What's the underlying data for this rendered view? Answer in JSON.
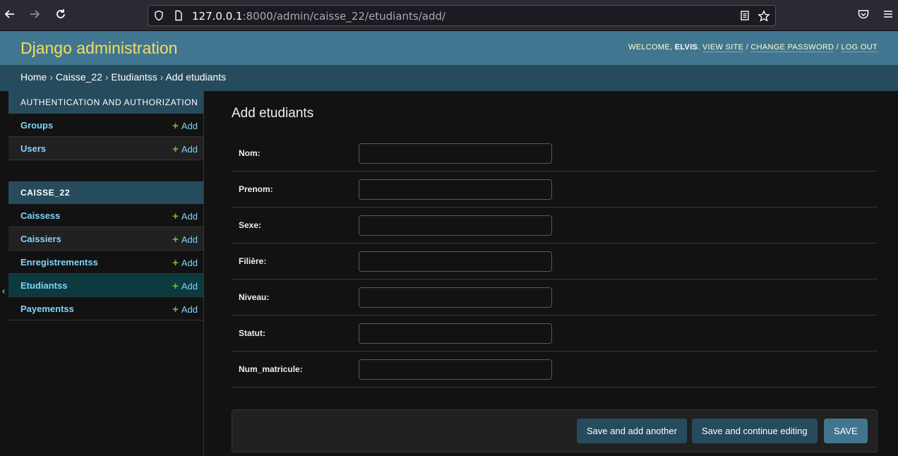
{
  "browser": {
    "url_host": "127.0.0.1",
    "url_rest": ":8000/admin/caisse_22/etudiants/add/",
    "back_icon": "arrow-left-icon",
    "forward_icon": "arrow-right-icon",
    "reload_icon": "reload-icon"
  },
  "header": {
    "branding": "Django administration",
    "welcome": "WELCOME, ",
    "username": "ELVIS",
    "dot": ". ",
    "view_site": "VIEW SITE",
    "sep1": " / ",
    "change_password": "CHANGE PASSWORD",
    "sep2": " / ",
    "log_out": "LOG OUT"
  },
  "breadcrumbs": {
    "home": "Home",
    "sep": " › ",
    "app": "Caisse_22",
    "model": "Etudiantss",
    "current": "Add etudiants"
  },
  "sidebar": {
    "modules": [
      {
        "caption": "AUTHENTICATION AND AUTHORIZATION",
        "items": [
          {
            "name": "Groups",
            "add": "Add"
          },
          {
            "name": "Users",
            "add": "Add"
          }
        ]
      },
      {
        "caption": "CAISSE_22",
        "items": [
          {
            "name": "Caissess",
            "add": "Add"
          },
          {
            "name": "Caissiers",
            "add": "Add"
          },
          {
            "name": "Enregistrementss",
            "add": "Add"
          },
          {
            "name": "Etudiantss",
            "add": "Add"
          },
          {
            "name": "Payementss",
            "add": "Add"
          }
        ]
      }
    ],
    "toggle": "‹"
  },
  "content": {
    "title": "Add etudiants",
    "fields": [
      {
        "label": "Nom:",
        "value": ""
      },
      {
        "label": "Prenom:",
        "value": ""
      },
      {
        "label": "Sexe:",
        "value": ""
      },
      {
        "label": "Filière:",
        "value": ""
      },
      {
        "label": "Niveau:",
        "value": ""
      },
      {
        "label": "Statut:",
        "value": ""
      },
      {
        "label": "Num_matricule:",
        "value": ""
      }
    ],
    "buttons": {
      "save_add_another": "Save and add another",
      "save_continue": "Save and continue editing",
      "save": "SAVE"
    }
  },
  "colors": {
    "header_bg": "#417690",
    "breadcrumbs_bg": "#264b5d",
    "branding": "#f5dd5d",
    "link": "#81d4fa",
    "add_plus": "#70bf2b"
  }
}
